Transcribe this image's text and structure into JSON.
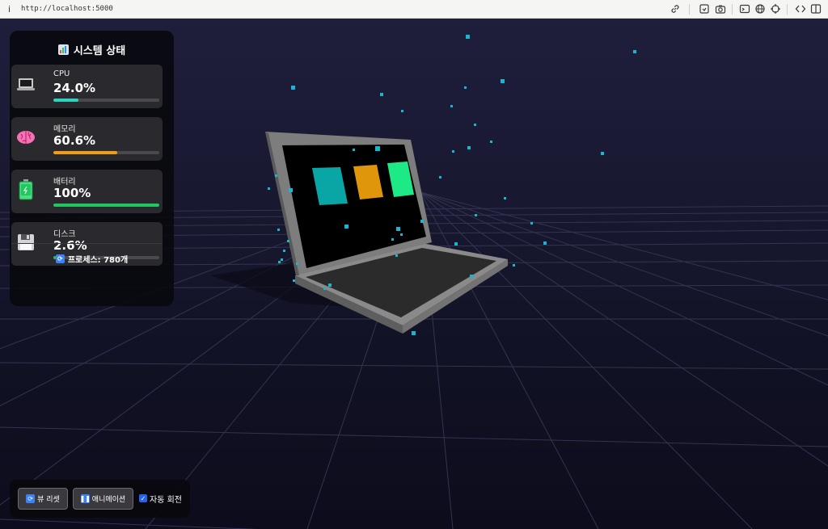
{
  "browser": {
    "info_glyph": "i",
    "url": "http://localhost:5000"
  },
  "panel": {
    "title": "시스템 상태",
    "metrics": [
      {
        "label": "CPU",
        "value": "24.0%",
        "percent": 24.0,
        "color": "#2dd4bf",
        "icon": "laptop-icon"
      },
      {
        "label": "메모리",
        "value": "60.6%",
        "percent": 60.6,
        "color": "#f59e0b",
        "icon": "brain-icon"
      },
      {
        "label": "배터리",
        "value": "100%",
        "percent": 100,
        "color": "#22c55e",
        "icon": "battery-icon"
      },
      {
        "label": "디스크",
        "value": "2.6%",
        "percent": 2.6,
        "color": "#22c55e",
        "icon": "floppy-disk-icon"
      }
    ],
    "process_text": "프로세스: 780개"
  },
  "controls": {
    "reset_label": "뷰 리셋",
    "animation_label": "애니메이션",
    "auto_rotate_label": "자동 회전",
    "auto_rotate_checked": true
  },
  "scene": {
    "screen_tile_colors": [
      "#0aa6a6",
      "#e0960a",
      "#1de987"
    ],
    "particle_color": "#19b6d2"
  }
}
